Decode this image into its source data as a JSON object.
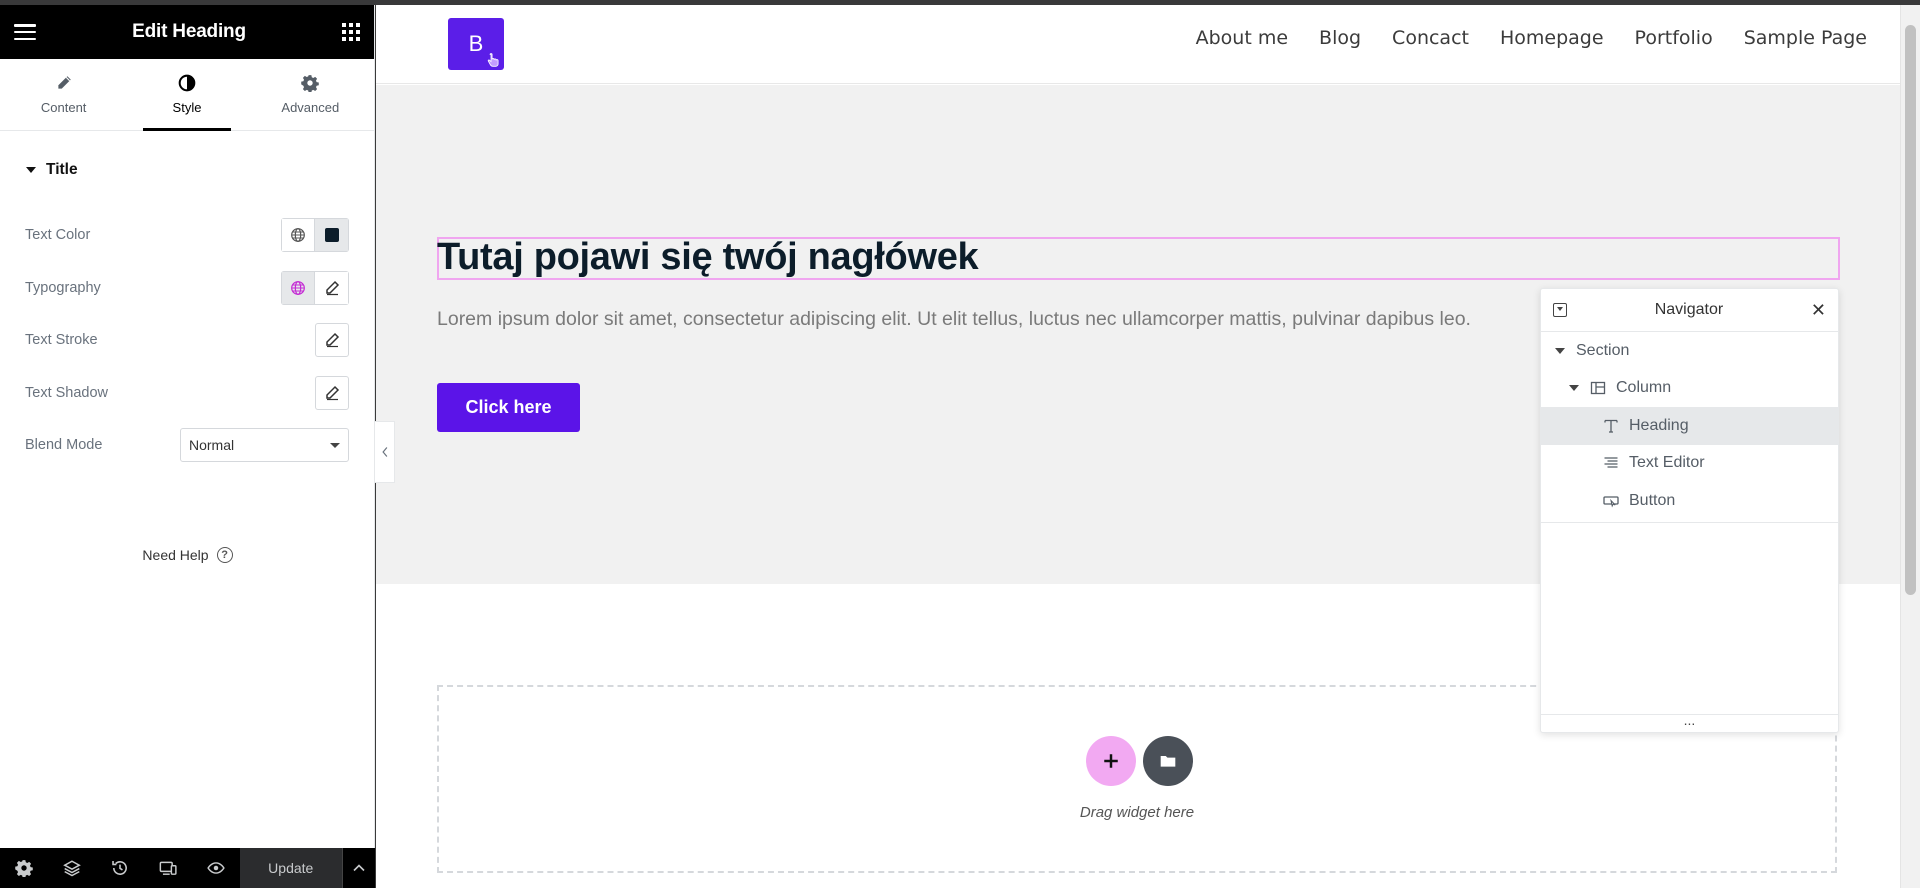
{
  "panel": {
    "title": "Edit Heading",
    "tabs": [
      {
        "label": "Content",
        "icon": "pencil-icon"
      },
      {
        "label": "Style",
        "icon": "contrast-icon"
      },
      {
        "label": "Advanced",
        "icon": "gear-icon"
      }
    ],
    "active_tab": "Style",
    "section_title": "Title",
    "controls": {
      "text_color": "Text Color",
      "typography": "Typography",
      "text_stroke": "Text Stroke",
      "text_shadow": "Text Shadow",
      "blend_mode": "Blend Mode",
      "blend_mode_value": "Normal"
    },
    "help_label": "Need Help",
    "update_label": "Update",
    "text_color_swatch": "#0c1d2a"
  },
  "site": {
    "logo_letter": "B",
    "nav": [
      "About me",
      "Blog",
      "Concact",
      "Homepage",
      "Portfolio",
      "Sample Page"
    ],
    "heading": "Tutaj pojawi się twój nagłówek",
    "paragraph": "Lorem ipsum dolor sit amet, consectetur adipiscing elit. Ut elit tellus, luctus nec ullamcorper mattis, pulvinar dapibus leo.",
    "button_label": "Click here",
    "drop_label": "Drag widget here"
  },
  "navigator": {
    "title": "Navigator",
    "items": [
      {
        "label": "Section",
        "icon": "caret-down-icon"
      },
      {
        "label": "Column",
        "icon": "column-icon"
      },
      {
        "label": "Heading",
        "icon": "heading-icon",
        "selected": true
      },
      {
        "label": "Text Editor",
        "icon": "text-editor-icon"
      },
      {
        "label": "Button",
        "icon": "button-icon"
      }
    ],
    "footer_handle": "..."
  },
  "colors": {
    "accent": "#5b14e8",
    "highlight": "#f0a6f0",
    "heading": "#0c1d2a"
  }
}
